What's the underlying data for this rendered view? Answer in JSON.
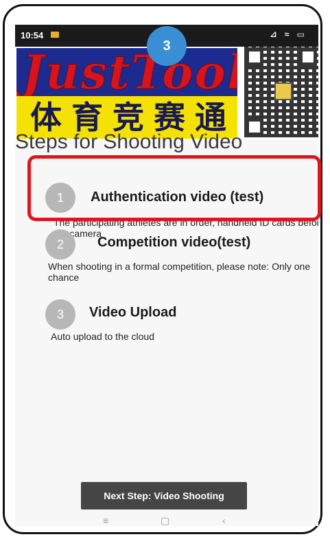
{
  "status": {
    "time": "10:54",
    "icons": "⊿ ≈ ▭"
  },
  "banner": {
    "logo_text": "JustTool",
    "chinese_text": "体育竞赛通"
  },
  "badge": {
    "number": "3"
  },
  "page": {
    "title": "Steps for Shooting Video"
  },
  "steps": [
    {
      "number": "1",
      "title": "Authentication video (test)",
      "description": "The participating athletes are in order, handheld ID cards before the camera"
    },
    {
      "number": "2",
      "title": "Competition video(test)",
      "description": "When shooting in a formal competition, please note: Only one chance"
    },
    {
      "number": "3",
      "title": "Video Upload",
      "description": "Auto upload to the cloud"
    }
  ],
  "next_button": {
    "label": "Next Step: Video Shooting"
  },
  "nav": {
    "menu": "≡",
    "home": "▢",
    "back": "‹"
  },
  "colors": {
    "highlight": "#e0161f",
    "badge": "#3a8fd4",
    "step_circle": "#b7b7b7",
    "button": "#454545"
  }
}
